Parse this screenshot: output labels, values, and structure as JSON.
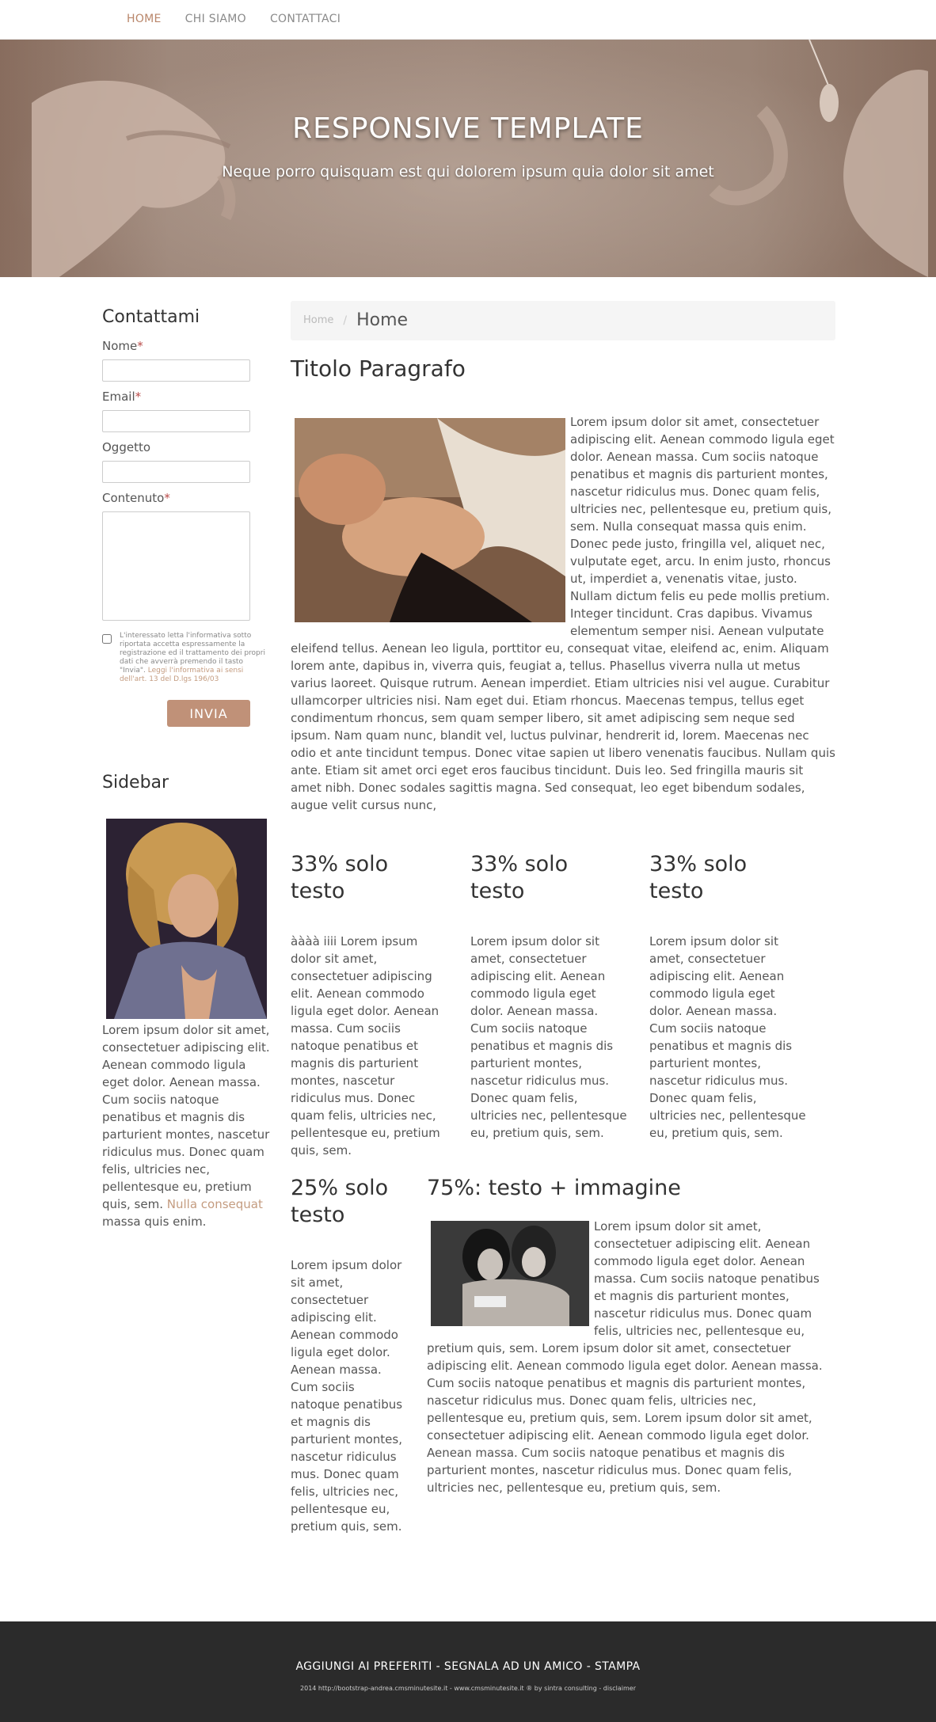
{
  "nav": {
    "items": [
      {
        "label": "HOME",
        "active": true
      },
      {
        "label": "CHI SIAMO",
        "active": false
      },
      {
        "label": "CONTATTACI",
        "active": false
      }
    ]
  },
  "hero": {
    "title": "RESPONSIVE TEMPLATE",
    "subtitle": "Neque porro quisquam est qui dolorem ipsum quia dolor sit amet"
  },
  "contact_form": {
    "title": "Contattami",
    "name_label": "Nome",
    "email_label": "Email",
    "subject_label": "Oggetto",
    "content_label": "Contenuto",
    "required_mark": "*",
    "privacy_text": "L'interessato letta l'informativa sotto riportata accetta espressamente la registrazione ed il trattamento dei propri dati che avverrà premendo il tasto \"Invia\".",
    "privacy_link": "Leggi l'informativa ai sensi dell'art. 13 del D.lgs 196/03",
    "submit_label": "INVIA"
  },
  "sidebar": {
    "title": "Sidebar",
    "text": "Lorem ipsum dolor sit amet, consectetuer adipiscing elit. Aenean commodo ligula eget dolor. Aenean massa. Cum sociis natoque penatibus et magnis dis parturient montes, nascetur ridiculus mus. Donec quam felis, ultricies nec, pellentesque eu, pretium quis, sem.",
    "link_text": "Nulla consequat",
    "text_after": "massa quis enim."
  },
  "breadcrumb": {
    "home": "Home",
    "separator": "/",
    "current": "Home"
  },
  "main": {
    "title": "Titolo Paragrafo",
    "text": "Lorem ipsum dolor sit amet, consectetuer adipiscing elit. Aenean commodo ligula eget dolor. Aenean massa. Cum sociis natoque penatibus et magnis dis parturient montes, nascetur ridiculus mus. Donec quam felis, ultricies nec, pellentesque eu, pretium quis, sem. Nulla consequat massa quis enim. Donec pede justo, fringilla vel, aliquet nec, vulputate eget, arcu. In enim justo, rhoncus ut, imperdiet a, venenatis vitae, justo. Nullam dictum felis eu pede mollis pretium. Integer tincidunt. Cras dapibus. Vivamus elementum semper nisi. Aenean vulputate eleifend tellus. Aenean leo ligula, porttitor eu, consequat vitae, eleifend ac, enim. Aliquam lorem ante, dapibus in, viverra quis, feugiat a, tellus. Phasellus viverra nulla ut metus varius laoreet. Quisque rutrum. Aenean imperdiet. Etiam ultricies nisi vel augue. Curabitur ullamcorper ultricies nisi. Nam eget dui. Etiam rhoncus. Maecenas tempus, tellus eget condimentum rhoncus, sem quam semper libero, sit amet adipiscing sem neque sed ipsum. Nam quam nunc, blandit vel, luctus pulvinar, hendrerit id, lorem. Maecenas nec odio et ante tincidunt tempus. Donec vitae sapien ut libero venenatis faucibus. Nullam quis ante. Etiam sit amet orci eget eros faucibus tincidunt. Duis leo. Sed fringilla mauris sit amet nibh. Donec sodales sagittis magna. Sed consequat, leo eget bibendum sodales, augue velit cursus nunc,"
  },
  "columns33": [
    {
      "title": "33% solo testo",
      "text": "àààà iiii Lorem ipsum dolor sit amet, consectetuer adipiscing elit. Aenean commodo ligula eget dolor. Aenean massa. Cum sociis natoque penatibus et magnis dis parturient montes, nascetur ridiculus mus. Donec quam felis, ultricies nec, pellentesque eu, pretium quis, sem."
    },
    {
      "title": "33% solo testo",
      "text": "Lorem ipsum dolor sit amet, consectetuer adipiscing elit. Aenean commodo ligula eget dolor. Aenean massa. Cum sociis natoque penatibus et magnis dis parturient montes, nascetur ridiculus mus. Donec quam felis, ultricies nec, pellentesque eu, pretium quis, sem."
    },
    {
      "title": "33% solo testo",
      "text": "Lorem ipsum dolor sit amet, consectetuer adipiscing elit. Aenean commodo ligula eget dolor. Aenean massa. Cum sociis natoque penatibus et magnis dis parturient montes, nascetur ridiculus mus. Donec quam felis, ultricies nec, pellentesque eu, pretium quis, sem."
    }
  ],
  "column25": {
    "title": "25% solo testo",
    "text": "Lorem ipsum dolor sit amet, consectetuer adipiscing elit. Aenean commodo ligula eget dolor. Aenean massa. Cum sociis natoque penatibus et magnis dis parturient montes, nascetur ridiculus mus. Donec quam felis, ultricies nec, pellentesque eu, pretium quis, sem."
  },
  "column75": {
    "title": "75%: testo + immagine",
    "text": "Lorem ipsum dolor sit amet, consectetuer adipiscing elit. Aenean commodo ligula eget dolor. Aenean massa. Cum sociis natoque penatibus et magnis dis parturient montes, nascetur ridiculus mus. Donec quam felis, ultricies nec, pellentesque eu, pretium quis, sem. Lorem ipsum dolor sit amet, consectetuer adipiscing elit. Aenean commodo ligula eget dolor. Aenean massa. Cum sociis natoque penatibus et magnis dis parturient montes, nascetur ridiculus mus. Donec quam felis, ultricies nec, pellentesque eu, pretium quis, sem. Lorem ipsum dolor sit amet, consectetuer adipiscing elit. Aenean commodo ligula eget dolor. Aenean massa. Cum sociis natoque penatibus et magnis dis parturient montes, nascetur ridiculus mus. Donec quam felis, ultricies nec, pellentesque eu, pretium quis, sem."
  },
  "footer": {
    "links": "AGGIUNGI AI PREFERITI - SEGNALA AD UN AMICO - STAMPA",
    "copyright": "2014 http://bootstrap-andrea.cmsminutesite.it - www.cmsminutesite.it ® by sintra consulting - disclaimer"
  },
  "colors": {
    "accent": "#c09178",
    "nav_active": "#b9866a",
    "footer_bg": "#2b2b2b"
  }
}
